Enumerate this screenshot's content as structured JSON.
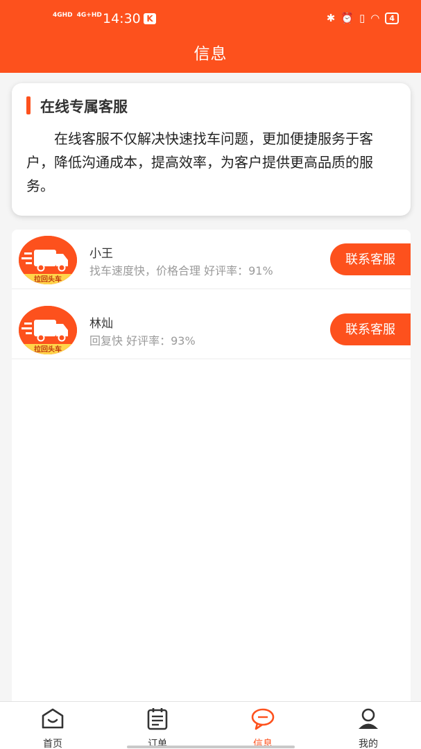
{
  "status_bar": {
    "network_1": "4GHD",
    "network_2": "4G+HD",
    "time": "14:30",
    "k_badge": "K",
    "battery": "4"
  },
  "header": {
    "title": "信息"
  },
  "intro": {
    "title": "在线专属客服",
    "text": "在线客服不仅解决快速找车问题，更加便捷服务于客户，降低沟通成本，提高效率，为客户提供更高品质的服务。"
  },
  "agents": [
    {
      "name": "小王",
      "desc": "找车速度快，价格合理 好评率：91%",
      "button": "联系客服",
      "avatar_caption": "拉回头车"
    },
    {
      "name": "林灿",
      "desc": "回复快 好评率：93%",
      "button": "联系客服",
      "avatar_caption": "拉回头车"
    }
  ],
  "tabs": [
    {
      "label": "首页",
      "icon": "home-icon",
      "active": false
    },
    {
      "label": "订单",
      "icon": "order-icon",
      "active": false
    },
    {
      "label": "信息",
      "icon": "chat-icon",
      "active": true
    },
    {
      "label": "我的",
      "icon": "user-icon",
      "active": false
    }
  ],
  "colors": {
    "accent": "#fd511d",
    "background": "#f5f5f5"
  }
}
